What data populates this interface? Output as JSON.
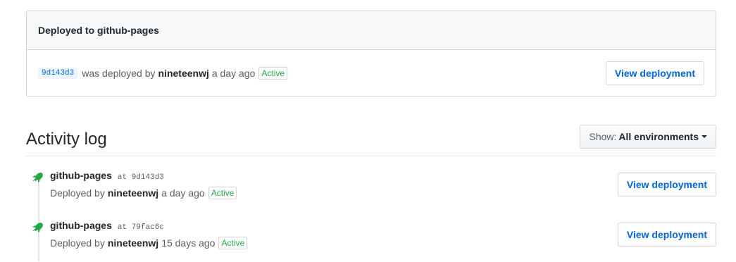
{
  "deployed_box": {
    "title": "Deployed to github-pages",
    "sha": "9d143d3",
    "text_was_deployed_by": "was deployed by",
    "user": "nineteenwj",
    "time": "a day ago",
    "status": "Active",
    "button": "View deployment"
  },
  "activity": {
    "title": "Activity log",
    "filter_label": "Show:",
    "filter_value": "All environments",
    "items": [
      {
        "env": "github-pages",
        "at": "at 9d143d3",
        "deployed_by": "Deployed by",
        "user": "nineteenwj",
        "time": "a day ago",
        "status": "Active",
        "button": "View deployment"
      },
      {
        "env": "github-pages",
        "at": "at 79fac6c",
        "deployed_by": "Deployed by",
        "user": "nineteenwj",
        "time": "15 days ago",
        "status": "Active",
        "button": "View deployment"
      }
    ]
  },
  "colors": {
    "link": "#0366d6",
    "active": "#28a745",
    "rocket": "#28a745"
  }
}
